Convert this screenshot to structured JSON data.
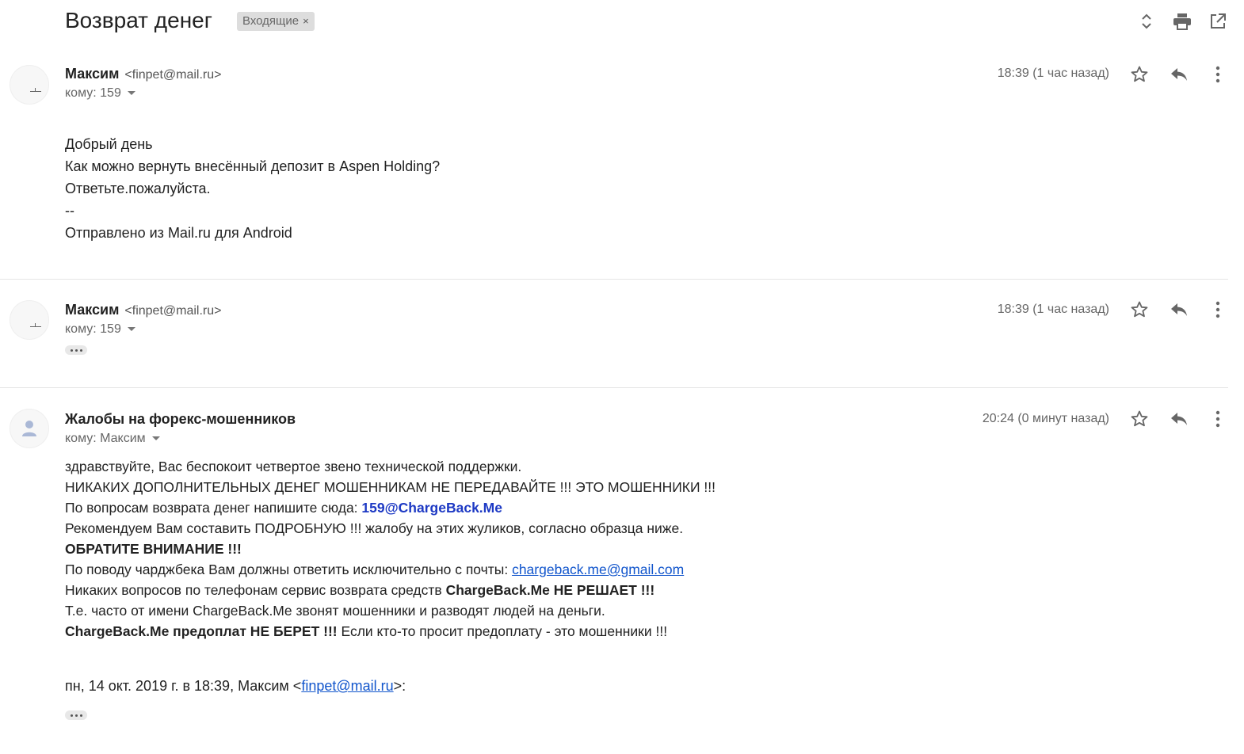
{
  "thread": {
    "subject": "Возврат денег",
    "label": "Входящие",
    "label_close": "×",
    "icons": [
      "expand-collapse-icon",
      "print-icon",
      "open-new-window-icon"
    ]
  },
  "messages": [
    {
      "sender_name": "Максим",
      "sender_email": "<finpet@mail.ru>",
      "recipient": "кому: 159",
      "time": "18:39 (1 час назад)",
      "body": [
        "Добрый день",
        "Как можно вернуть внесённый депозит в Aspen Holding?",
        "Ответьте.пожалуйста.",
        "--",
        "Отправлено из Mail.ru для Android"
      ]
    },
    {
      "sender_name": "Максим",
      "sender_email": "<finpet@mail.ru>",
      "recipient": "кому: 159",
      "time": "18:39 (1 час назад)"
    },
    {
      "sender_name": "Жалобы на форекс-мошенников",
      "recipient": "кому: Максим",
      "time": "20:24 (0 минут назад)",
      "body": {
        "l1": "здравствуйте, Вас беспокоит четвертое звено технической поддержки.",
        "l2": "НИКАКИХ ДОПОЛНИТЕЛЬНЫХ ДЕНЕГ МОШЕННИКАМ НЕ ПЕРЕДАВАЙТЕ !!! ЭТО МОШЕННИКИ !!!",
        "l3_prefix": "По вопросам возврата денег напишите сюда: ",
        "l3_email": "159@ChargeBack.Me",
        "l4": "Рекомендуем Вам составить ПОДРОБНУЮ !!! жалобу на этих жуликов, согласно образца ниже.",
        "l5": "ОБРАТИТЕ ВНИМАНИЕ !!!",
        "l6_prefix": "По поводу чарджбека Вам должны ответить исключительно с почты: ",
        "l6_link": "chargeback.me@gmail.com",
        "l7_prefix": "Никаких вопросов по телефонам сервис возврата средств ",
        "l7_bold": "ChargeBack.Me НЕ РЕШАЕТ !!!",
        "l8": "Т.е. часто от имени ChargeBack.Me звонят мошенники и разводят людей на деньги.",
        "l9_bold": "ChargeBack.Me предоплат НЕ БЕРЕТ !!!",
        "l9_rest": " Если кто-то просит предоплату - это мошенники !!!"
      },
      "quote": {
        "prefix": "пн, 14 окт. 2019 г. в 18:39, Максим <",
        "email": "finpet@mail.ru",
        "suffix": ">:"
      }
    }
  ],
  "colors": {
    "link": "#1155cc",
    "divider": "#e5e5e5",
    "chip": "#dddddd"
  }
}
